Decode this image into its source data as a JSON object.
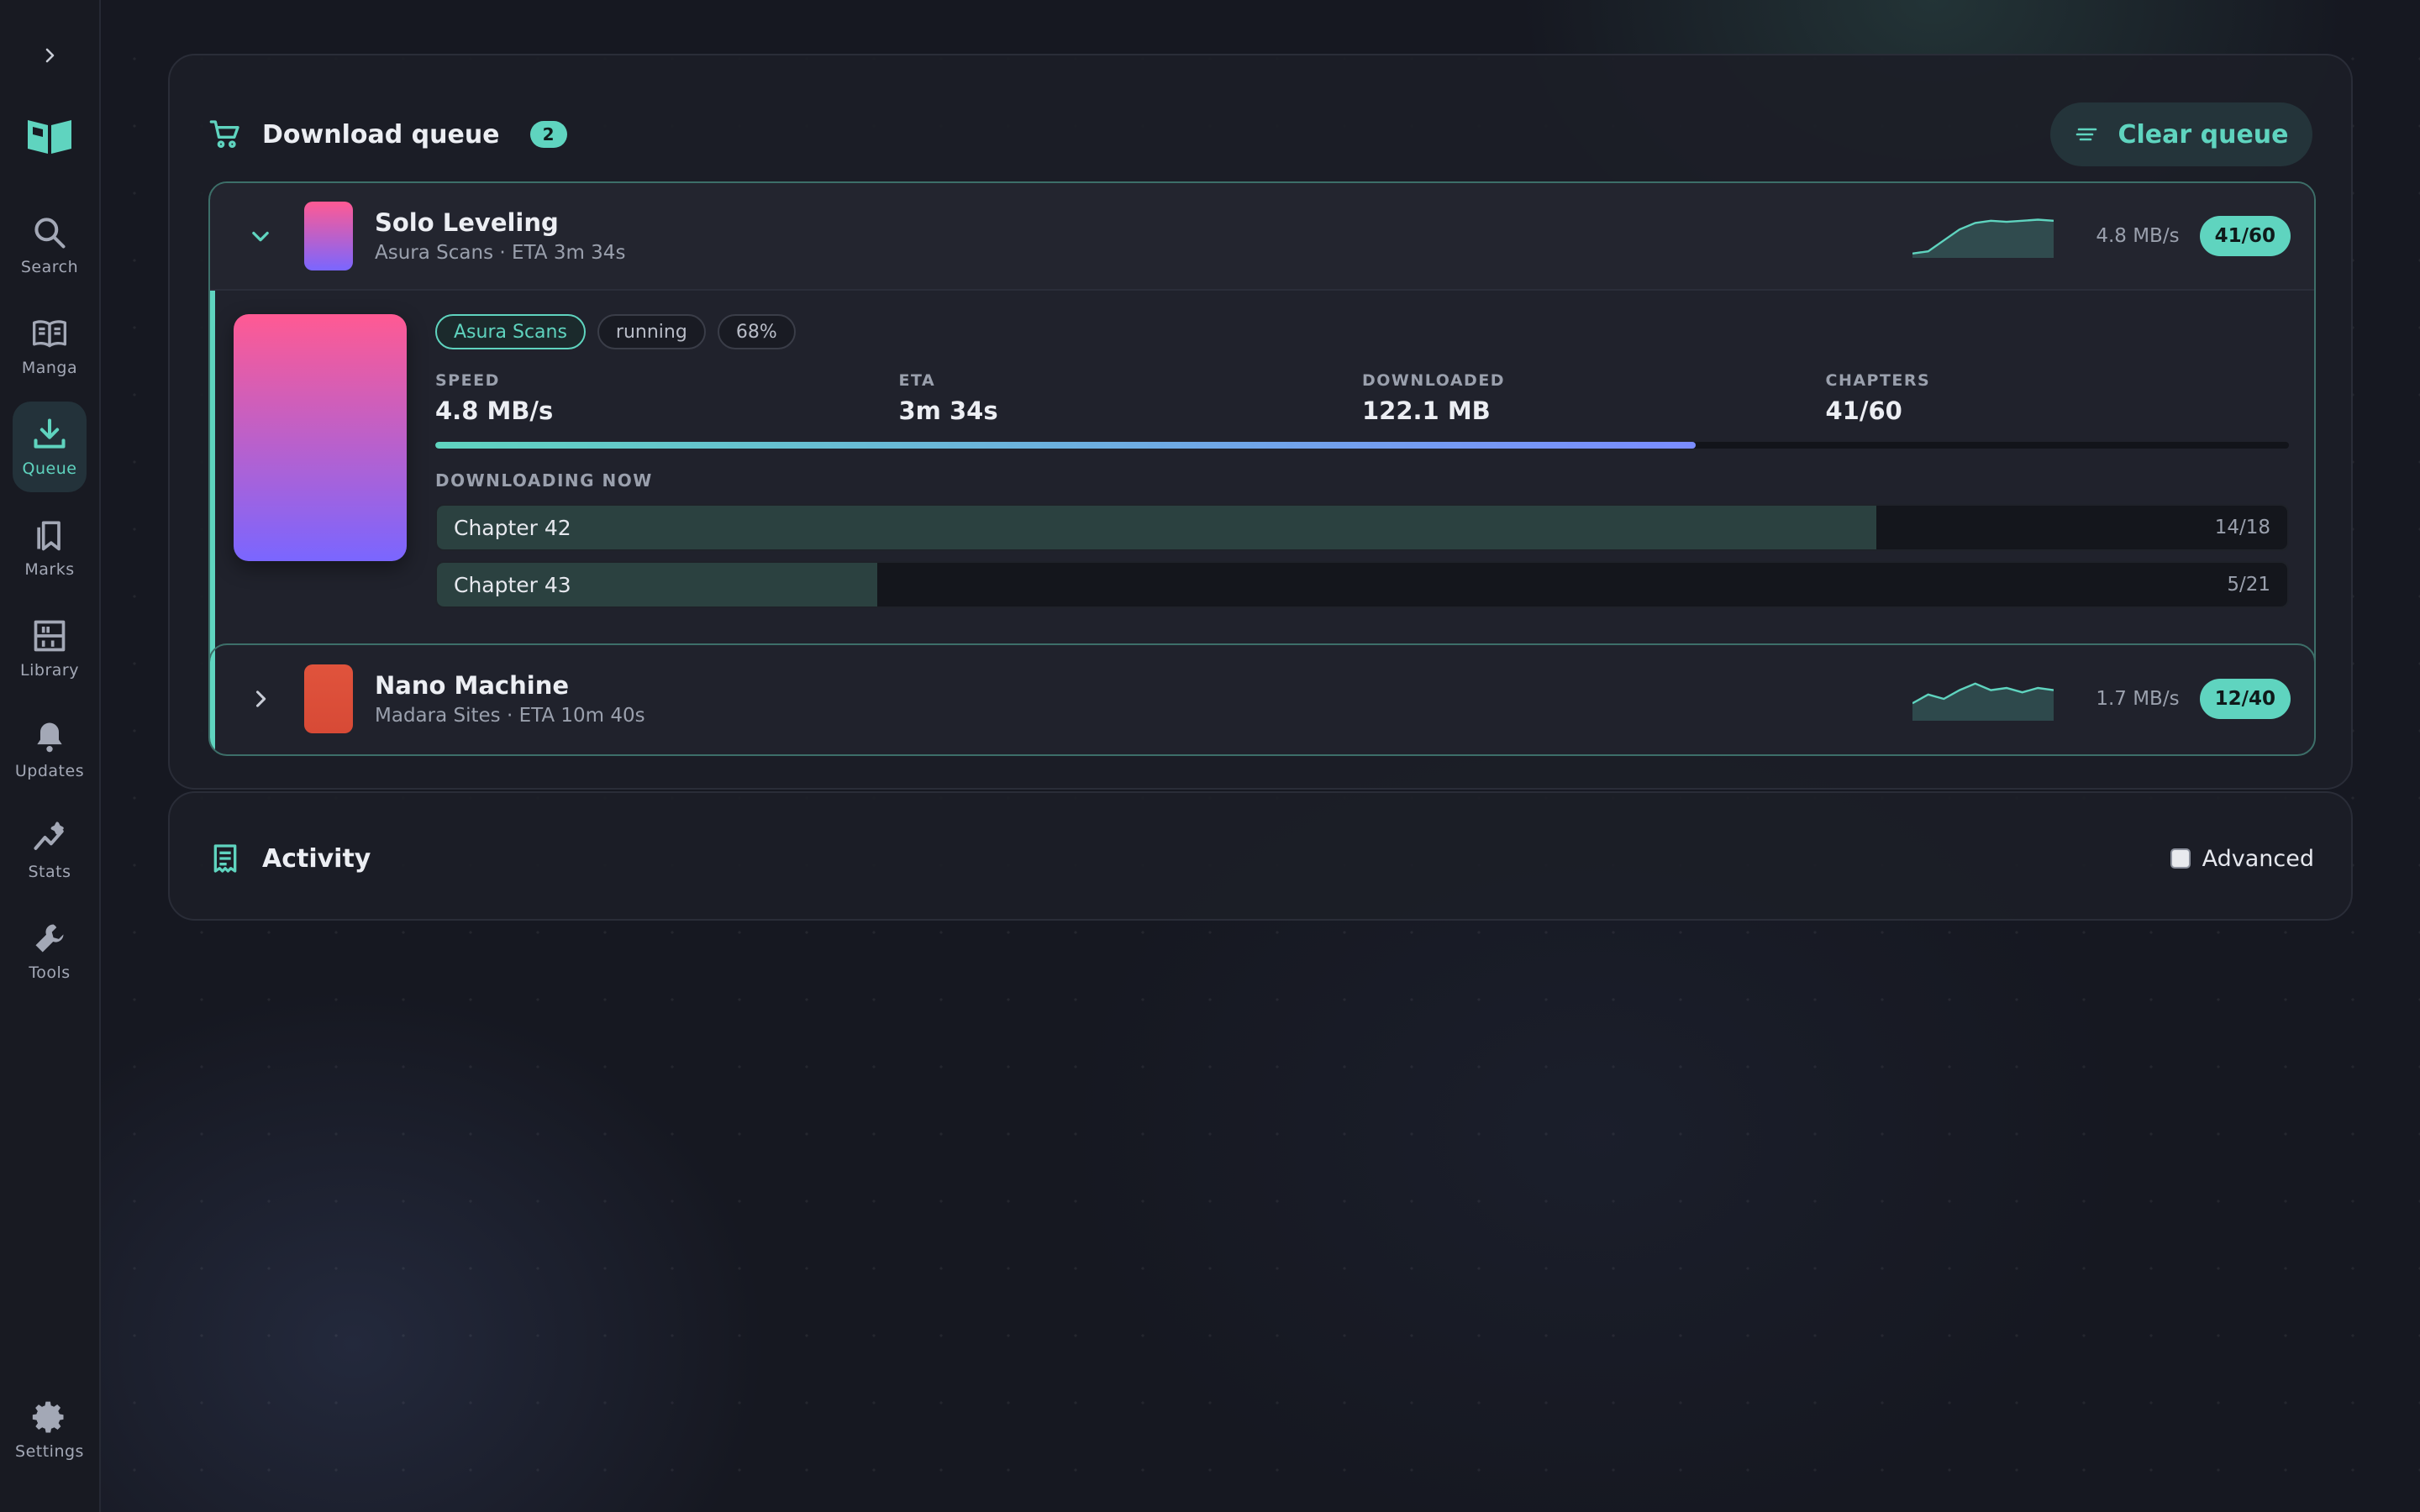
{
  "sidebar": {
    "items": [
      {
        "label": "Search",
        "icon": "search-icon"
      },
      {
        "label": "Manga",
        "icon": "book-icon"
      },
      {
        "label": "Queue",
        "icon": "download-icon"
      },
      {
        "label": "Marks",
        "icon": "bookmark-icon"
      },
      {
        "label": "Library",
        "icon": "shelf-icon"
      },
      {
        "label": "Updates",
        "icon": "bell-icon"
      },
      {
        "label": "Stats",
        "icon": "chart-icon"
      },
      {
        "label": "Tools",
        "icon": "wrench-icon"
      }
    ],
    "settings_label": "Settings",
    "active": "Queue"
  },
  "queue": {
    "title": "Download queue",
    "count": "2",
    "clear_label": "Clear queue",
    "items": [
      {
        "name": "Solo Leveling",
        "subtitle": "Asura Scans · ETA 3m 34s",
        "speed": "4.8 MB/s",
        "progress_badge": "41/60",
        "expanded": true,
        "pills": [
          "Asura Scans",
          "running",
          "68%"
        ],
        "stats": [
          {
            "label": "SPEED",
            "value": "4.8 MB/s"
          },
          {
            "label": "ETA",
            "value": "3m 34s"
          },
          {
            "label": "DOWNLOADED",
            "value": "122.1 MB"
          },
          {
            "label": "CHAPTERS",
            "value": "41/60"
          }
        ],
        "progress_percent": 68,
        "downloading_label": "DOWNLOADING NOW",
        "chapters": [
          {
            "name": "Chapter 42",
            "count": "14/18",
            "fraction": 0.778
          },
          {
            "name": "Chapter 43",
            "count": "5/21",
            "fraction": 0.238
          }
        ],
        "sparkline": [
          2,
          3,
          8,
          13,
          16,
          17,
          16.5,
          17,
          17.5,
          17
        ]
      },
      {
        "name": "Nano Machine",
        "subtitle": "Madara Sites · ETA 10m 40s",
        "speed": "1.7 MB/s",
        "progress_badge": "12/40",
        "expanded": false,
        "sparkline": [
          8,
          12,
          10,
          14,
          17,
          14,
          15,
          13,
          15,
          14
        ]
      }
    ]
  },
  "activity": {
    "title": "Activity",
    "advanced_label": "Advanced",
    "advanced_checked": false
  },
  "colors": {
    "accent": "#5fd4bf",
    "background": "#161821",
    "card": "#1c1e27"
  }
}
